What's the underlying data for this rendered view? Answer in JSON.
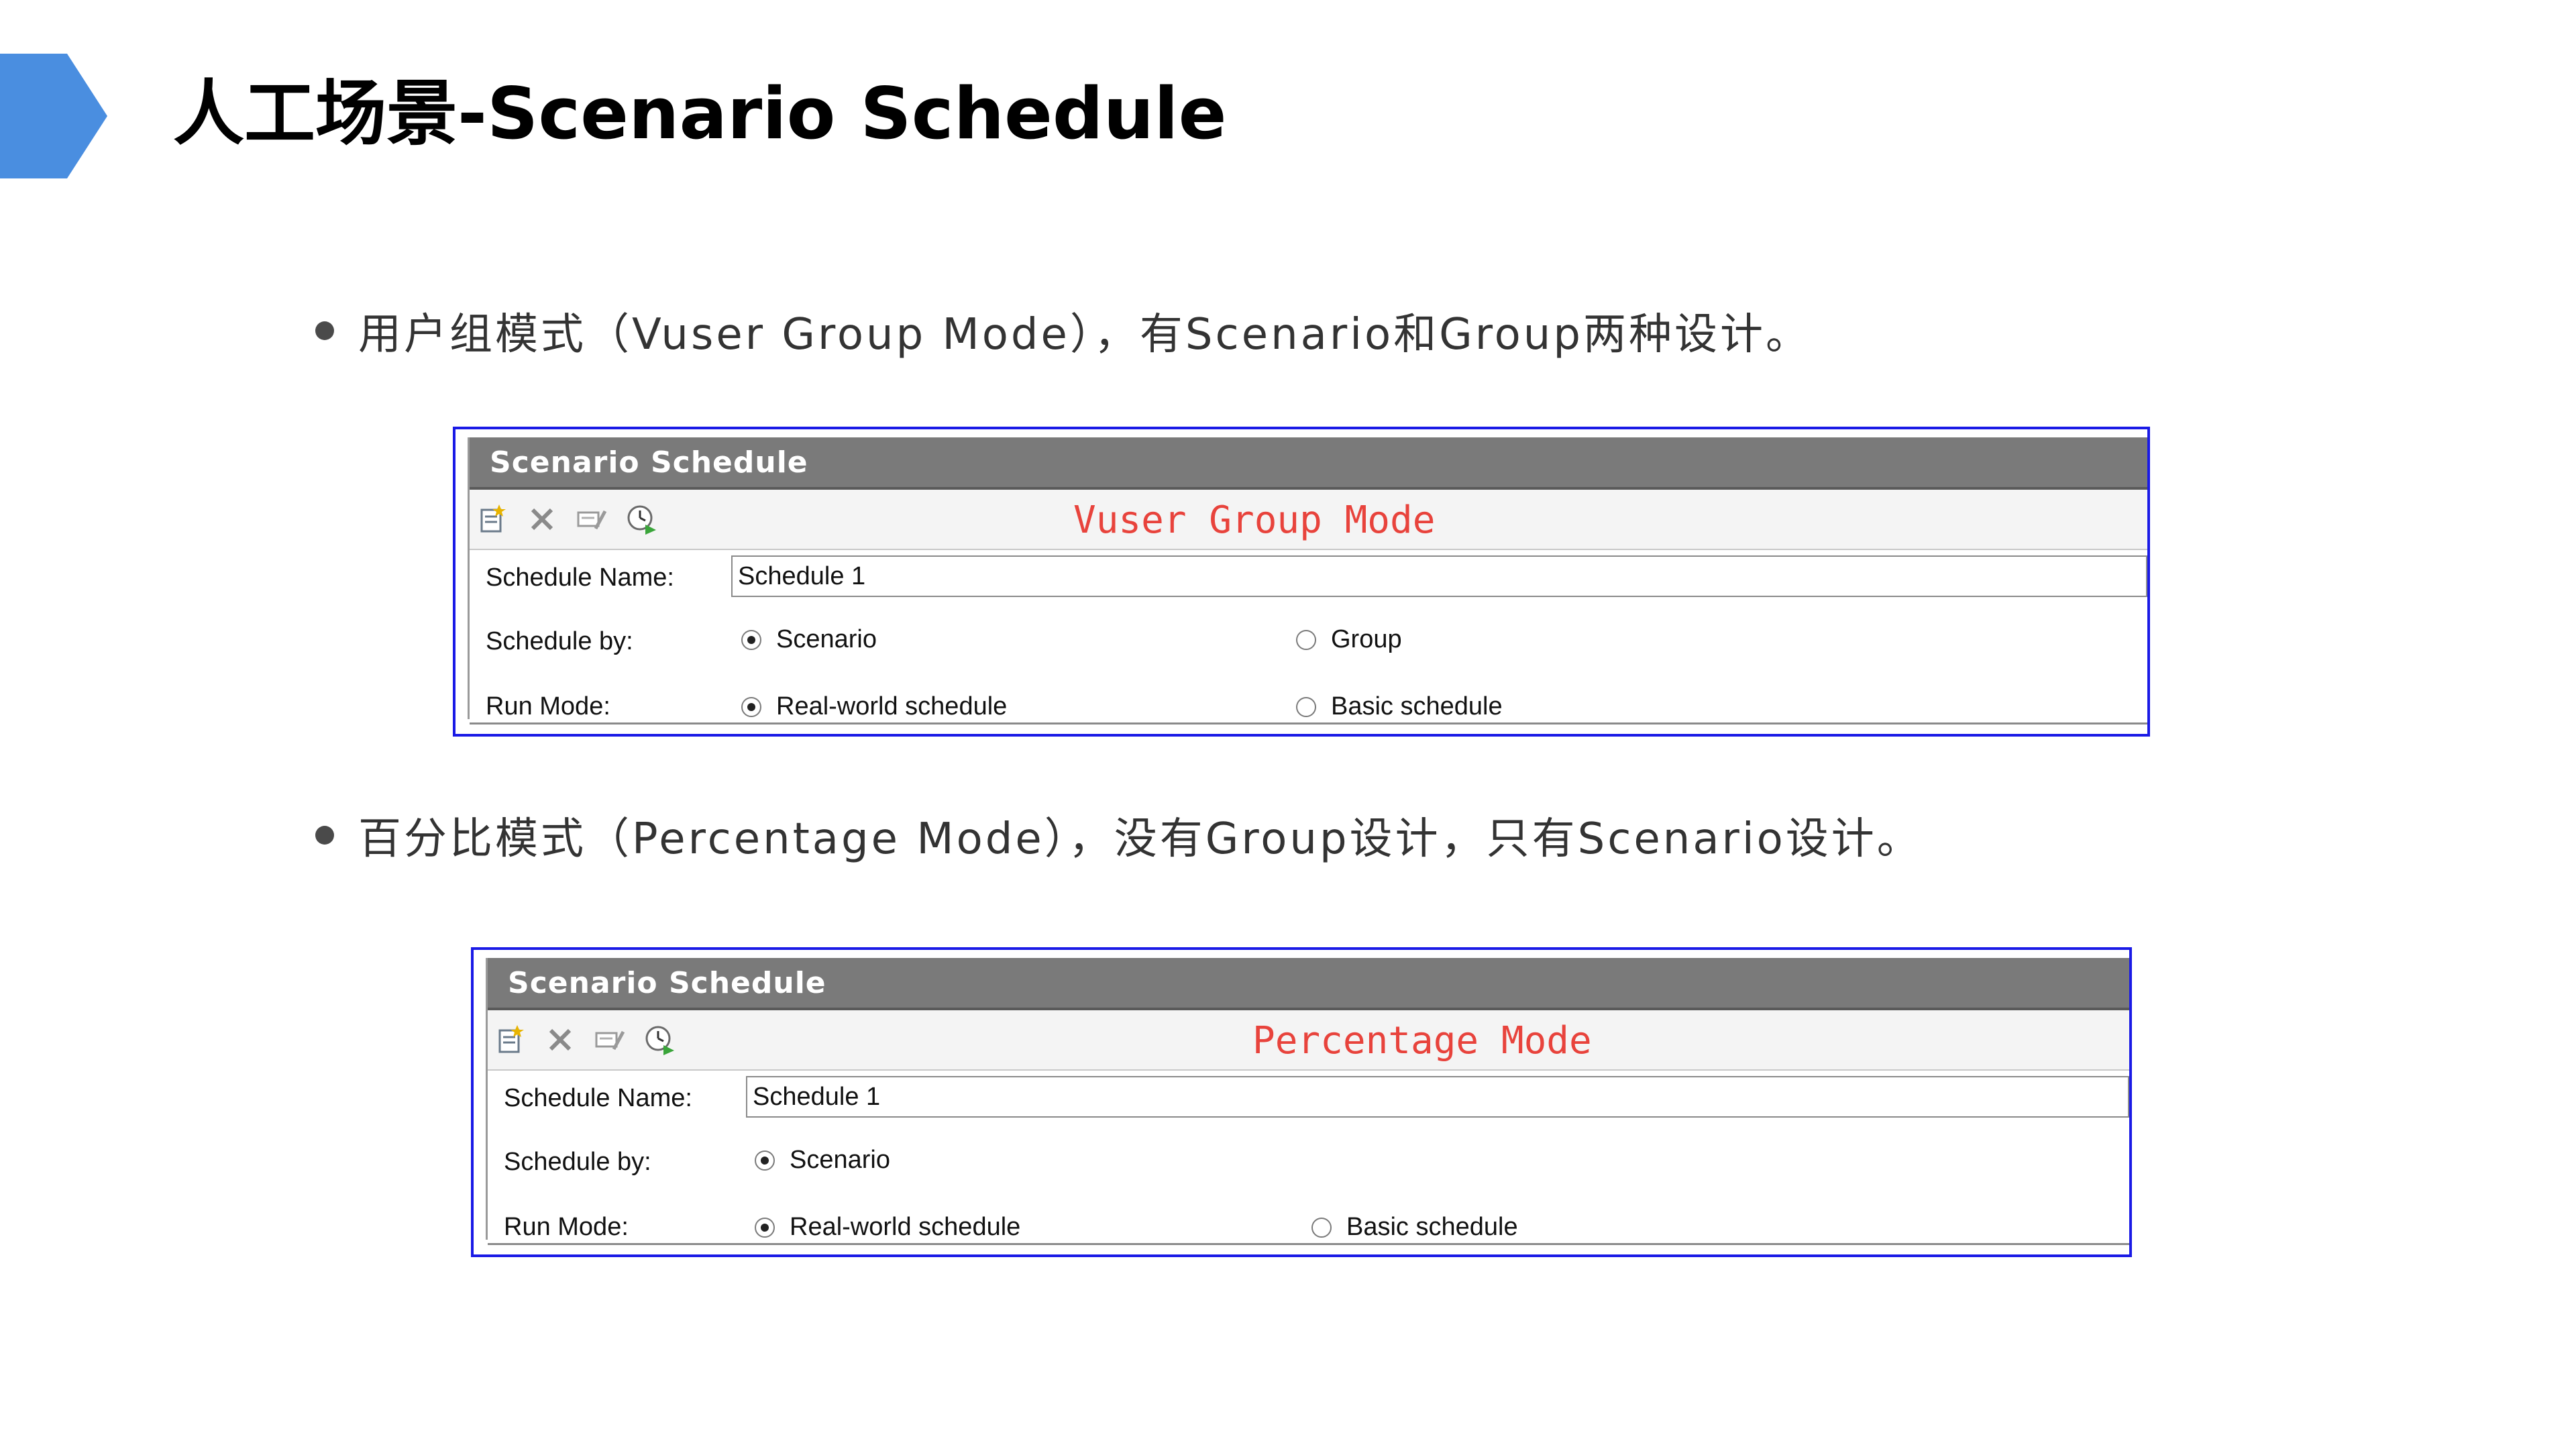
{
  "slide": {
    "title": "人工场景-Scenario Schedule",
    "accent_color": "#4a8ee0",
    "chevron_icon": "chevron-right-icon"
  },
  "bullets": [
    {
      "text": "用户组模式（Vuser Group Mode），有Scenario和Group两种设计。"
    },
    {
      "text": "百分比模式（Percentage Mode），没有Group设计，只有Scenario设计。"
    }
  ],
  "panels": [
    {
      "window_title": "Scenario Schedule",
      "mode_label": "Vuser Group Mode",
      "toolbar_icons": [
        "new-schedule-icon",
        "delete-icon",
        "rename-icon",
        "schedule-clock-icon"
      ],
      "schedule_name_label": "Schedule Name:",
      "schedule_name_value": "Schedule 1",
      "schedule_by_label": "Schedule by:",
      "schedule_by_options": [
        {
          "label": "Scenario",
          "checked": true
        },
        {
          "label": "Group",
          "checked": false
        }
      ],
      "run_mode_label": "Run Mode:",
      "run_mode_options": [
        {
          "label": "Real-world schedule",
          "checked": true
        },
        {
          "label": "Basic schedule",
          "checked": false
        }
      ]
    },
    {
      "window_title": "Scenario Schedule",
      "mode_label": "Percentage Mode",
      "toolbar_icons": [
        "new-schedule-icon",
        "delete-icon",
        "rename-icon",
        "schedule-clock-icon"
      ],
      "schedule_name_label": "Schedule Name:",
      "schedule_name_value": "Schedule 1",
      "schedule_by_label": "Schedule by:",
      "schedule_by_options": [
        {
          "label": "Scenario",
          "checked": true
        }
      ],
      "run_mode_label": "Run Mode:",
      "run_mode_options": [
        {
          "label": "Real-world schedule",
          "checked": true
        },
        {
          "label": "Basic schedule",
          "checked": false
        }
      ]
    }
  ]
}
